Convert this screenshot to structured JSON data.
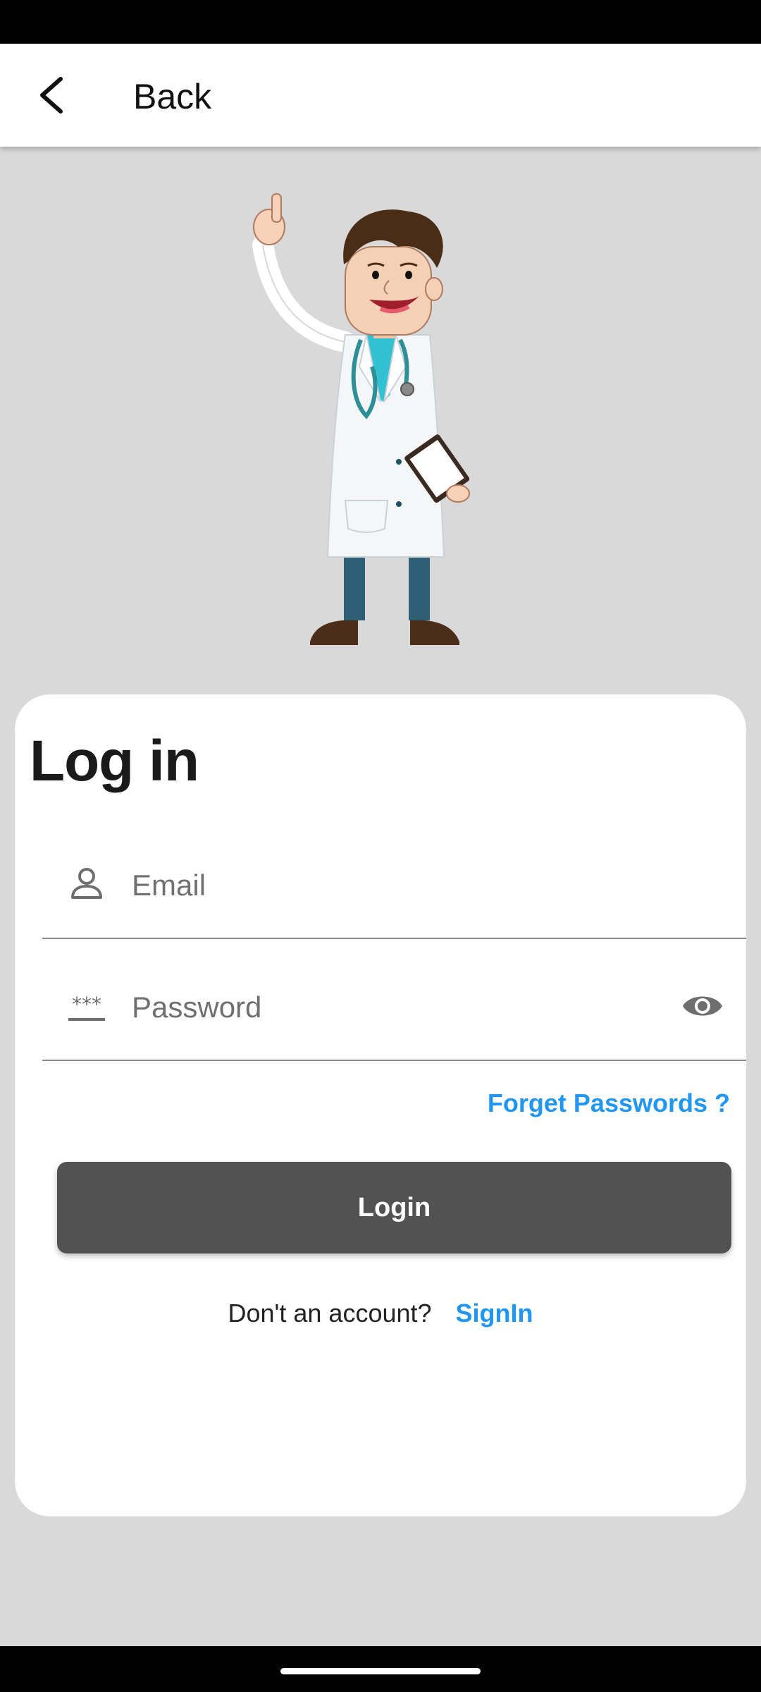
{
  "app_bar": {
    "back_icon": "chevron-left-icon",
    "title": "Back"
  },
  "illustration": {
    "subject": "cartoon doctor with stethoscope and clipboard"
  },
  "login": {
    "title": "Log in",
    "email": {
      "icon": "person-icon",
      "placeholder": "Email",
      "value": ""
    },
    "password": {
      "icon": "password-asterisk-icon",
      "placeholder": "Password",
      "value": "",
      "toggle_icon": "eye-icon"
    },
    "forget_link": "Forget Passwords ?",
    "submit_label": "Login",
    "signup_prompt": "Don't an account?",
    "signup_link": "SignIn"
  },
  "colors": {
    "background": "#d9d9d9",
    "card": "#ffffff",
    "accent_link": "#2196f3",
    "button": "#525252",
    "title_text": "#1a1a1a"
  }
}
